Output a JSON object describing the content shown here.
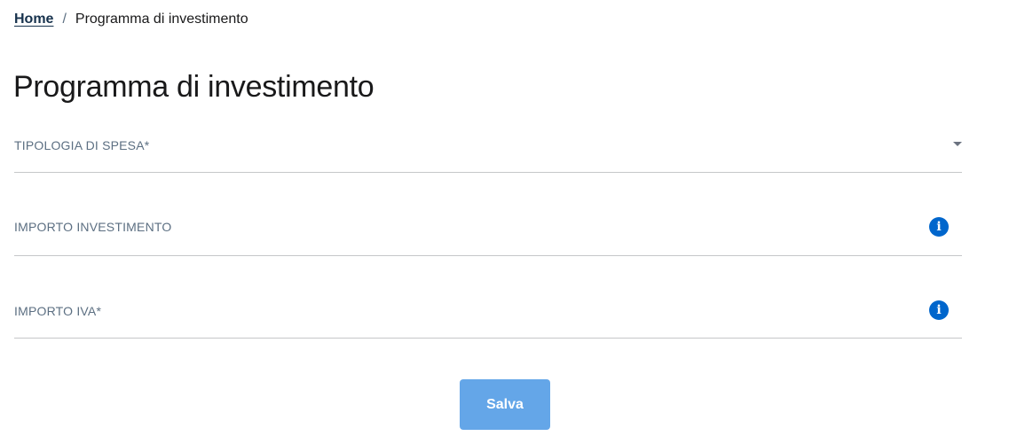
{
  "breadcrumb": {
    "home": "Home",
    "separator": "/",
    "current": "Programma di investimento"
  },
  "page": {
    "title": "Programma di investimento"
  },
  "form": {
    "tipologia_spesa": {
      "label": "TIPOLOGIA DI SPESA*",
      "icon": "chevron-down-icon"
    },
    "importo_investimento": {
      "label": "IMPORTO INVESTIMENTO",
      "icon": "info-icon"
    },
    "importo_iva": {
      "label": "IMPORTO IVA*",
      "icon": "info-icon"
    },
    "info_glyph": "i",
    "save_label": "Salva"
  },
  "colors": {
    "link": "#17324d",
    "info_icon": "#0066cc",
    "save_button": "#64a6e8",
    "field_label": "#5c6f82",
    "divider": "#c5c7c9"
  }
}
